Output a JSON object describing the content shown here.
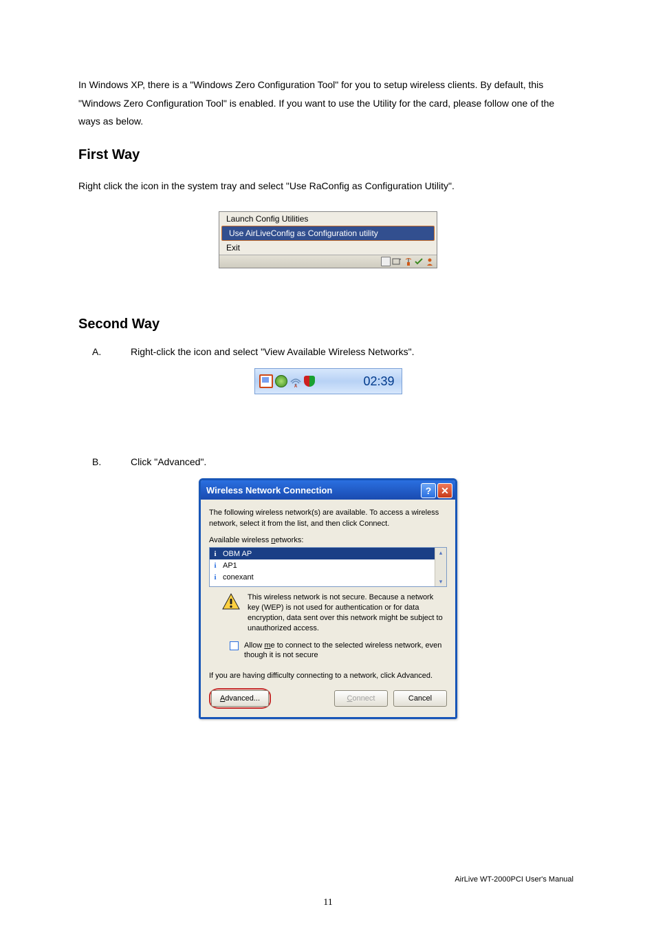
{
  "intro_text": "In Windows XP, there is a \"Windows Zero Configuration Tool\" for you to setup wireless clients. By default, this \"Windows Zero Configuration Tool\" is enabled. If you want to use the Utility for the card, please follow one of the ways as below.",
  "first_way": {
    "heading": "First Way",
    "text": "Right click the icon in the system tray and select \"Use RaConfig as Configuration Utility\"."
  },
  "ctxmenu": {
    "items": [
      "Launch Config Utilities",
      "Use AirLiveConfig as Configuration utility",
      "Exit"
    ],
    "selected_index": 1
  },
  "second_way": {
    "heading": "Second Way",
    "steps": [
      {
        "letter": "A.",
        "text": "Right-click the icon and select \"View Available Wireless Networks\"."
      },
      {
        "letter": "B.",
        "text": "Click \"Advanced\"."
      }
    ]
  },
  "systray": {
    "clock": "02:39"
  },
  "dlg": {
    "title": "Wireless Network Connection",
    "description": "The following wireless network(s) are available. To access a wireless network, select it from the list, and then click Connect.",
    "list_label_prefix": "Available wireless ",
    "list_label_underlined": "n",
    "list_label_suffix": "etworks:",
    "networks": [
      "OBM AP",
      "AP1",
      "conexant"
    ],
    "selected_network_index": 0,
    "warning": "This wireless network is not secure. Because a network key (WEP) is not used for authentication or for data encryption, data sent over this network might be subject to unauthorized access.",
    "checkbox_prefix": "Allow ",
    "checkbox_under": "m",
    "checkbox_suffix": "e to connect to the selected wireless network, even though it is not secure",
    "trouble": "If you are having difficulty connecting to a network, click Advanced.",
    "btn_advanced_under": "A",
    "btn_advanced_suffix": "dvanced...",
    "btn_connect_under": "C",
    "btn_connect_suffix": "onnect",
    "btn_cancel": "Cancel"
  },
  "footer": "AirLive WT-2000PCI User's Manual",
  "page_number": "11"
}
